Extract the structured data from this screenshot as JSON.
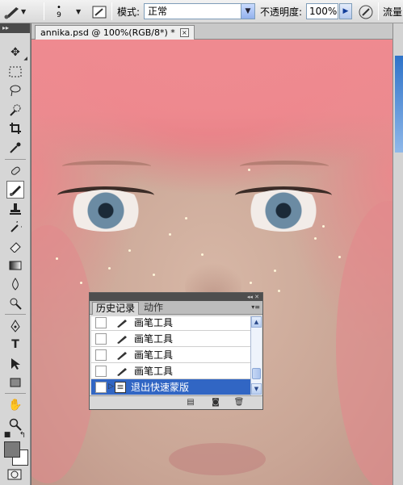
{
  "options_bar": {
    "brush_size": "9",
    "mode_label": "模式:",
    "mode_value": "正常",
    "opacity_label": "不透明度:",
    "opacity_value": "100%",
    "flow_label": "流量"
  },
  "document": {
    "tab_title": "annika.psd @ 100%(RGB/8*) *",
    "close_glyph": "×"
  },
  "history_panel": {
    "tabs": [
      "历史记录",
      "动作"
    ],
    "rows": [
      {
        "label": "画笔工具",
        "selected": false
      },
      {
        "label": "画笔工具",
        "selected": false
      },
      {
        "label": "画笔工具",
        "selected": false
      },
      {
        "label": "画笔工具",
        "selected": false
      },
      {
        "label": "退出快速蒙版",
        "selected": true
      }
    ]
  },
  "icons": {
    "brush": "brush-icon",
    "airbrush": "airbrush-icon",
    "mask": "quick-mask-icon"
  }
}
